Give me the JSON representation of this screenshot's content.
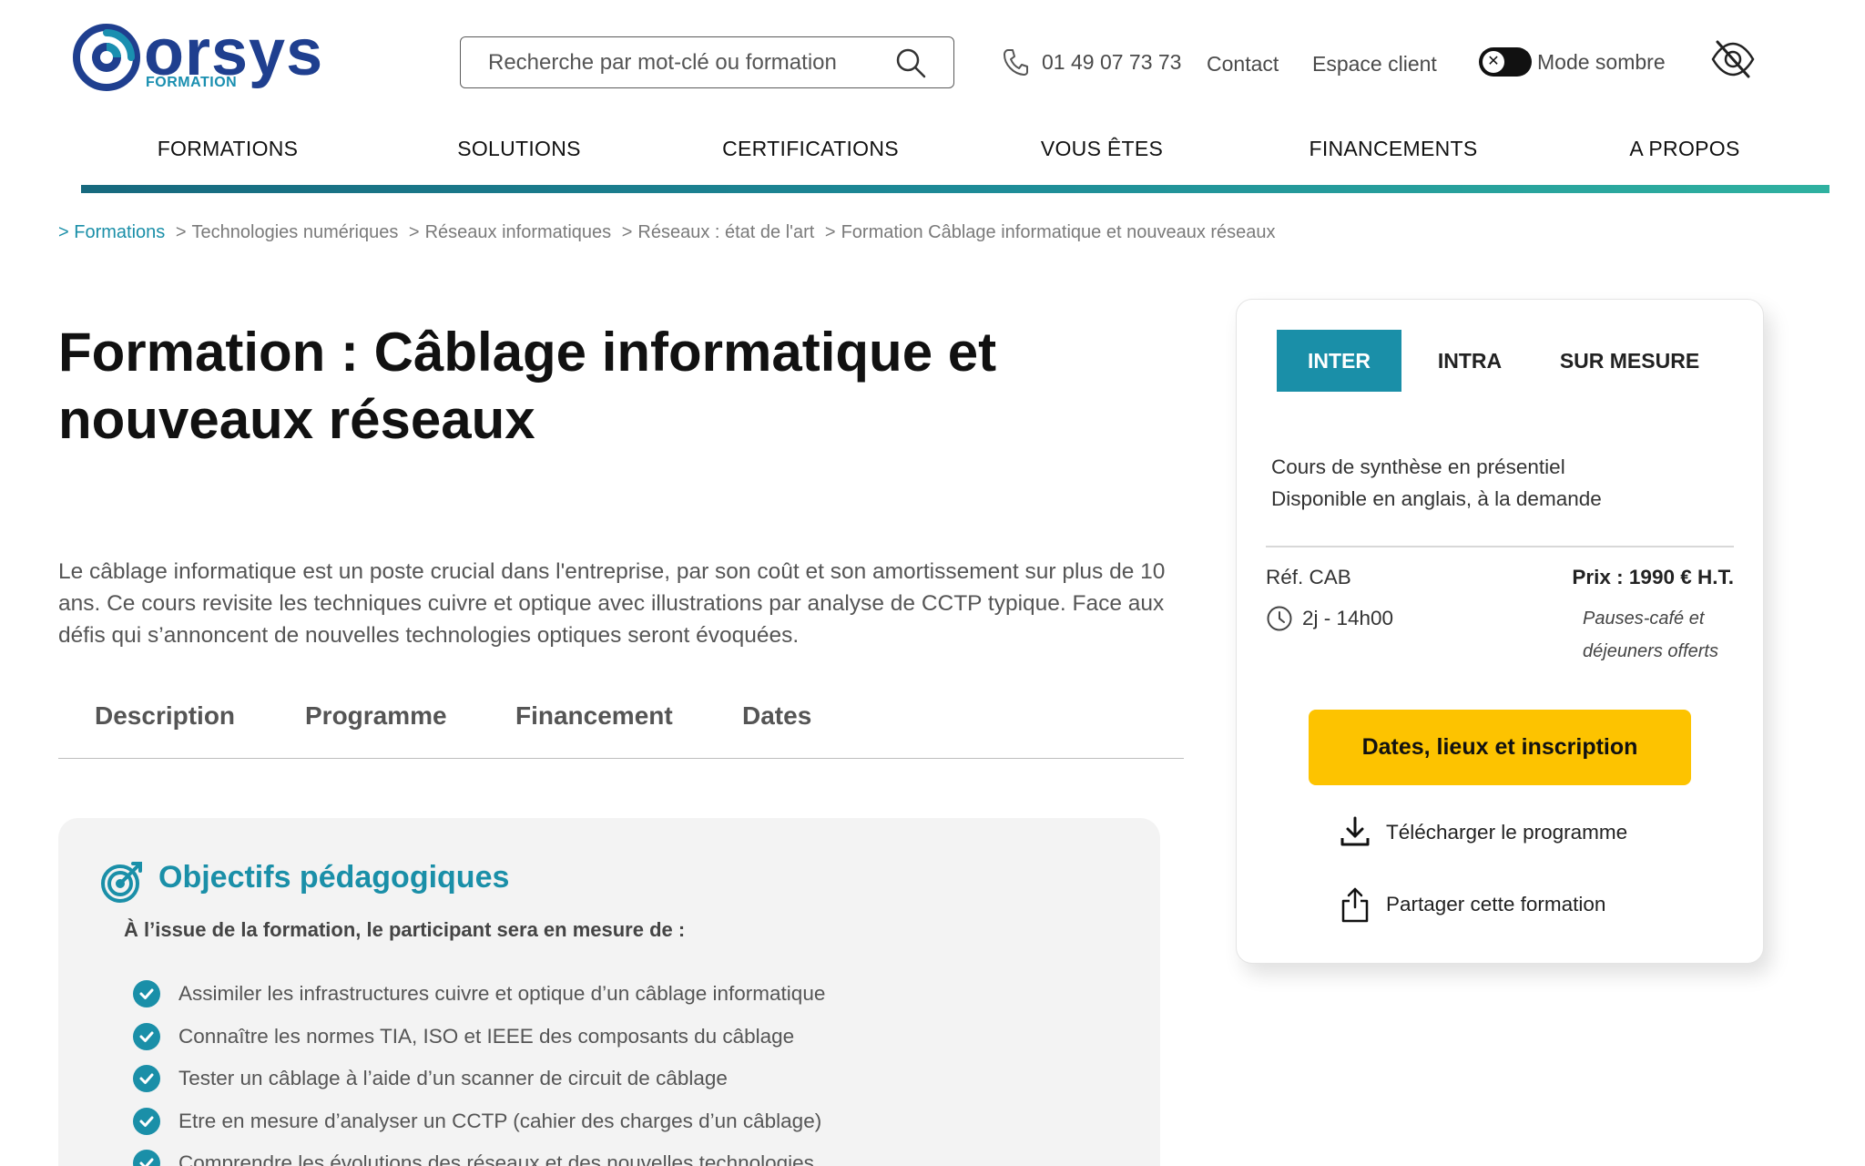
{
  "brand": {
    "name": "orsys",
    "sub": "FORMATION",
    "colors": {
      "primary": "#1f3f8f",
      "accent": "#1a8fa8",
      "cta": "#fdc300"
    }
  },
  "header": {
    "search_placeholder": "Recherche par mot-clé ou formation",
    "phone": "01 49 07 73 73",
    "contact": "Contact",
    "espace_client": "Espace client",
    "dark_mode": "Mode sombre",
    "toggle_symbol": "✕"
  },
  "nav": {
    "items": [
      "FORMATIONS",
      "SOLUTIONS",
      "CERTIFICATIONS",
      "VOUS ÊTES",
      "FINANCEMENTS",
      "A PROPOS"
    ]
  },
  "breadcrumb": {
    "items": [
      "> Formations",
      "Technologies numériques",
      "Réseaux informatiques",
      "Réseaux : état de l'art",
      "Formation Câblage informatique et nouveaux réseaux"
    ],
    "separator": ">"
  },
  "page": {
    "title": "Formation : Câblage informatique et nouveaux réseaux",
    "intro": "Le câblage informatique est un poste crucial dans l'entreprise, par son coût et son amortissement sur plus de 10 ans. Ce cours revisite les techniques cuivre et optique avec illustrations par analyse de CCTP typique. Face aux défis qui s’annoncent de nouvelles technologies optiques seront évoquées."
  },
  "tabs": [
    "Description",
    "Programme",
    "Financement",
    "Dates"
  ],
  "objectives": {
    "title": "Objectifs pédagogiques",
    "lead": "À l’issue de la formation, le participant sera en mesure de :",
    "items": [
      "Assimiler les infrastructures cuivre et optique d’un câblage informatique",
      "Connaître les normes TIA, ISO et IEEE des composants du câblage",
      "Tester un câblage à l’aide d’un scanner de circuit de câblage",
      "Etre en mesure d’analyser un CCTP (cahier des charges d’un câblage)",
      "Comprendre les évolutions des réseaux et des nouvelles technologies"
    ]
  },
  "sidebar": {
    "modes": [
      "INTER",
      "INTRA",
      "SUR MESURE"
    ],
    "active_mode": "INTER",
    "desc_1": "Cours de synthèse en présentiel",
    "desc_2": "Disponible en anglais, à la demande",
    "ref": "Réf. CAB",
    "duration": "2j - 14h00",
    "price": "Prix : 1990 € H.T.",
    "pauses_1": "Pauses-café et",
    "pauses_2": "déjeuners offerts",
    "cta": "Dates, lieux et inscription",
    "download": "Télécharger le programme",
    "share": "Partager cette formation"
  }
}
